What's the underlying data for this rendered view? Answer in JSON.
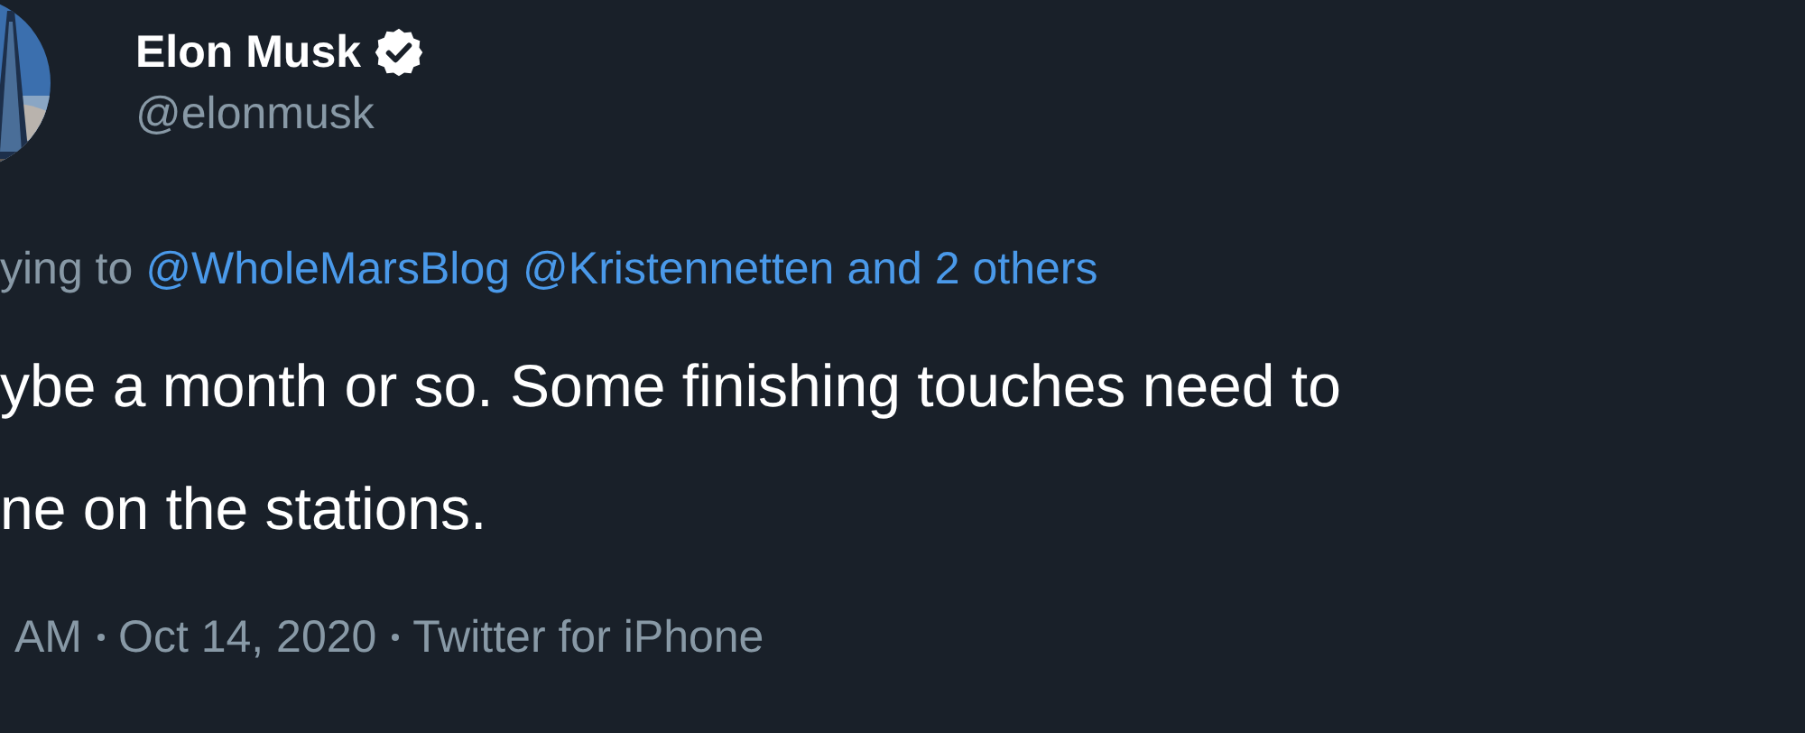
{
  "author": {
    "name": "Elon Musk",
    "verified": true,
    "handle": "@elonmusk"
  },
  "reply_to": {
    "prefix": "ying to",
    "mentions": [
      "@WholeMarsBlog",
      "@Kristennetten"
    ],
    "others": "and 2 others"
  },
  "body_lines": [
    "ybe a month or so. Some finishing touches need to",
    "ne on the stations."
  ],
  "meta": {
    "time": "AM",
    "date": "Oct 14, 2020",
    "source": "Twitter for iPhone"
  }
}
